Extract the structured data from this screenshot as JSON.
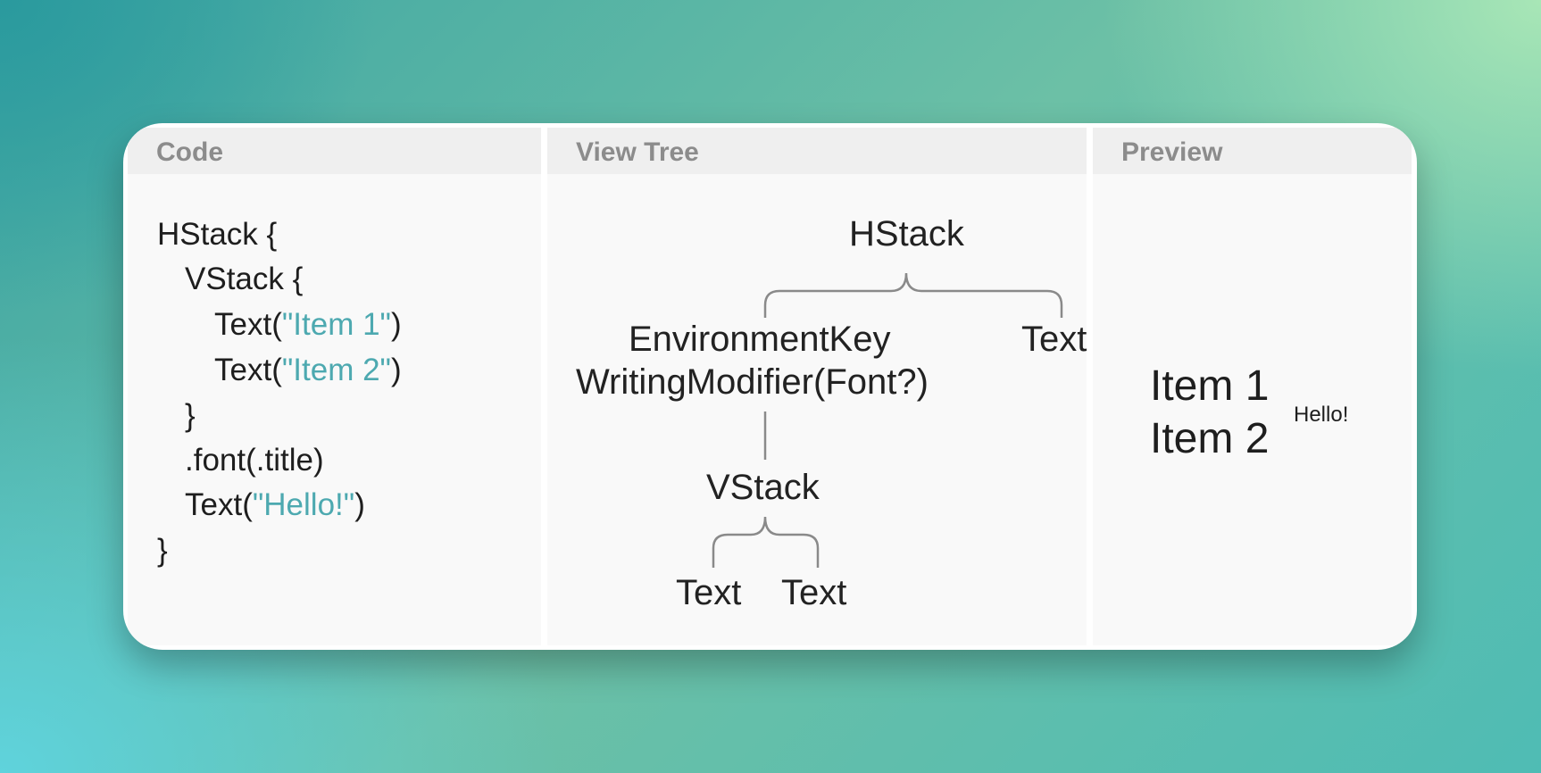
{
  "panels": {
    "code": {
      "title": "Code"
    },
    "tree": {
      "title": "View Tree"
    },
    "preview": {
      "title": "Preview"
    }
  },
  "code": {
    "l1": "HStack {",
    "l2": "VStack {",
    "l3_pre": "Text(",
    "l3_str": "\"Item 1\"",
    "l3_post": ")",
    "l4_pre": "Text(",
    "l4_str": "\"Item 2\"",
    "l4_post": ")",
    "l5": "}",
    "l6": ".font(.title)",
    "l7_pre": "Text(",
    "l7_str": "\"Hello!\"",
    "l7_post": ")",
    "l8": "}"
  },
  "tree": {
    "root": "HStack",
    "modifier_line1": "EnvironmentKey",
    "modifier_line2": "WritingModifier(Font?)",
    "text_right": "Text",
    "vstack": "VStack",
    "leaf_left": "Text",
    "leaf_right": "Text"
  },
  "preview": {
    "item1": "Item 1",
    "item2": "Item 2",
    "hello": "Hello!"
  },
  "colors": {
    "string_literal": "#4da9b0",
    "header_text": "#8c8c8c",
    "connector": "#8a8a8a"
  }
}
